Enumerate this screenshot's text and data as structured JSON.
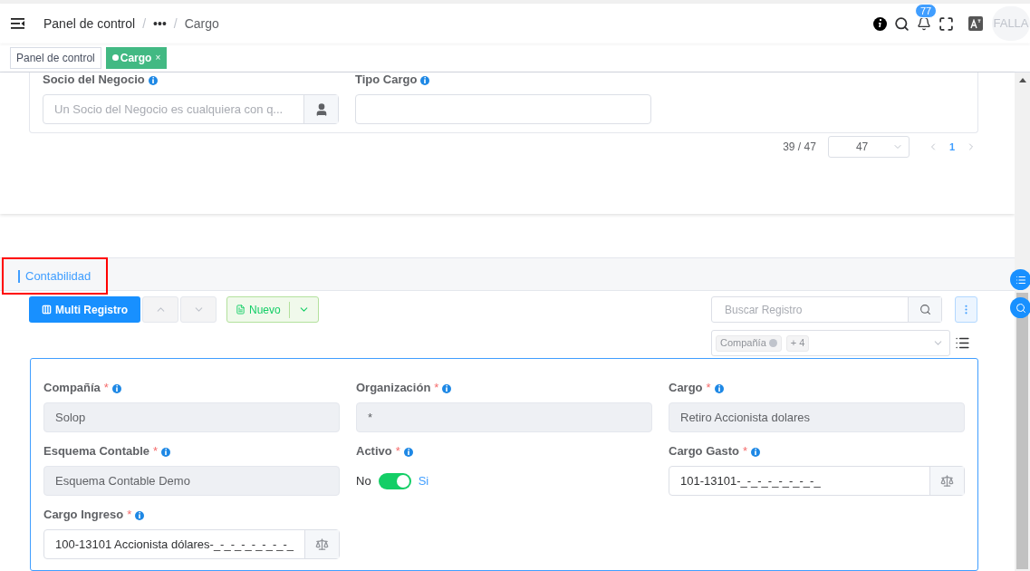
{
  "header": {
    "breadcrumbs": [
      "Panel de control",
      "•••",
      "Cargo"
    ],
    "separator": "/",
    "notifications": "77",
    "avatar": "FALLA"
  },
  "tabs": [
    {
      "label": "Panel de control",
      "selected": false
    },
    {
      "label": "Cargo",
      "selected": true,
      "close": "×"
    }
  ],
  "upper_form": {
    "fields": [
      {
        "label": "Socio del Negocio",
        "kind": "lookup",
        "placeholder": "Un Socio del Negocio es cualquiera con q..."
      },
      {
        "label": "Tipo Cargo",
        "kind": "text"
      }
    ]
  },
  "pagination": {
    "count": "39 / 47",
    "page_size": "47",
    "pages": [
      {
        "label": "1",
        "selected": true
      }
    ]
  },
  "section": {
    "title": "Contabilidad",
    "multi_button": "Multi Registro",
    "new_button": "Nuevo",
    "search": {
      "placeholder": "Buscar Registro"
    },
    "filter_tags": [
      "Compañía",
      "+ 4"
    ],
    "fields": [
      {
        "label": "Compañía",
        "required": "*",
        "kind": "readonly",
        "value": "Solop"
      },
      {
        "label": "Organización",
        "required": "*",
        "kind": "readonly",
        "value": "*"
      },
      {
        "label": "Cargo",
        "required": "*",
        "kind": "readonly",
        "value": "Retiro Accionista dolares"
      },
      {
        "label": "Esquema Contable",
        "required": "*",
        "kind": "readonly",
        "value": "Esquema Contable Demo"
      },
      {
        "label": "Activo",
        "required": "*",
        "kind": "switch",
        "off_label": "No",
        "on_label": "Si",
        "on": true
      },
      {
        "label": "Cargo Gasto",
        "required": "*",
        "kind": "lookup",
        "value": "101-13101-_-_-_-_-_-_-_-_"
      },
      {
        "label": "Cargo Ingreso",
        "required": "*",
        "kind": "lookup",
        "value": "100-13101 Accionista dólares-_-_-_-_-_-_-_-_"
      }
    ]
  }
}
